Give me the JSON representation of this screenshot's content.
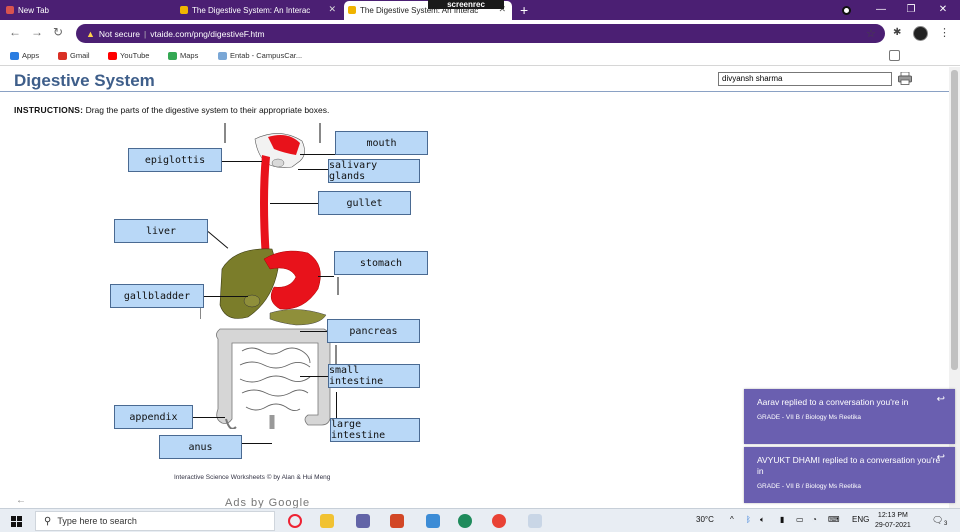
{
  "browser": {
    "tabs": [
      {
        "title": "New Tab",
        "active": false,
        "favicon_color": "#d9534f"
      },
      {
        "title": "The Digestive System: An Interac",
        "active": false,
        "favicon_color": "#f0b400"
      },
      {
        "title": "The Digestive System: An Interac",
        "active": true,
        "favicon_color": "#f0b400"
      }
    ],
    "recorder_badge": "screenrec",
    "address": {
      "security": "Not secure",
      "url": "vtaide.com/png/digestiveF.htm"
    },
    "bookmarks": [
      {
        "label": "Apps",
        "icon_color": "#2a7de1"
      },
      {
        "label": "Gmail",
        "icon_color": "#d93025"
      },
      {
        "label": "YouTube",
        "icon_color": "#ff0000"
      },
      {
        "label": "Maps",
        "icon_color": "#34a853"
      },
      {
        "label": "Entab - CampusCar...",
        "icon_color": "#7aa7d6"
      }
    ],
    "theme_color": "#4b1f73"
  },
  "page": {
    "title": "Digestive System",
    "user_name": "divyansh sharma",
    "instructions_bold": "INSTRUCTIONS:",
    "instructions_text": "Drag the parts of the digestive system to their appropriate boxes.",
    "labels": {
      "mouth": "mouth",
      "epiglottis": "epiglottis",
      "salivary_glands": "salivary glands",
      "gullet": "gullet",
      "liver": "liver",
      "stomach": "stomach",
      "gallbladder": "gallbladder",
      "pancreas": "pancreas",
      "small_intestine": "small intestine",
      "appendix": "appendix",
      "large_intestine": "large intestine",
      "anus": "anus"
    },
    "credit": "Interactive Science Worksheets © by Alan & Hui Meng",
    "ads_text": "Ads by Google",
    "label_color": "#b9d8f7"
  },
  "notifications": [
    {
      "message": "Aarav replied to a conversation you're in",
      "context": "GRADE - VII B / Biology Ms Reetika"
    },
    {
      "message": "AVYUKT DHAMI replied to a conversation you're in",
      "context": "GRADE - VII B / Biology Ms Reetika"
    }
  ],
  "taskbar": {
    "search_placeholder": "Type here to search",
    "temperature": "30°C",
    "language": "ENG",
    "time": "12:13 PM",
    "date": "29-07-2021",
    "notification_count": "3"
  }
}
